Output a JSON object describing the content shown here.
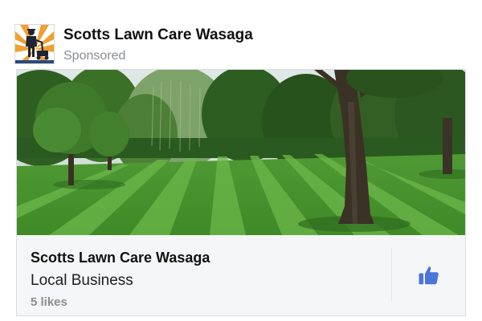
{
  "header": {
    "page_name": "Scotts Lawn Care Wasaga",
    "sponsored_label": "Sponsored",
    "avatar_icon": "lawn-mower-man-logo"
  },
  "card": {
    "image_subject": "striped mowed lawn with trees",
    "title": "Scotts Lawn Care Wasaga",
    "category": "Local Business",
    "likes": "5 likes",
    "like_icon": "thumbs-up-icon"
  },
  "colors": {
    "like_blue": "#4a76d9",
    "logo_orange": "#f0a030",
    "muted_text": "#8a8d91"
  }
}
